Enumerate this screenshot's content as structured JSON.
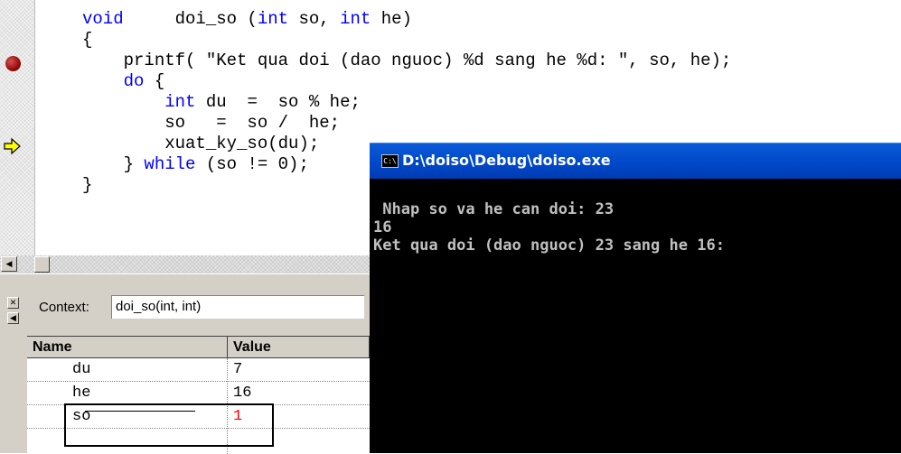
{
  "editor": {
    "lines": [
      {
        "parts": [
          {
            "t": "void",
            "kw": true
          },
          {
            "t": "     doi_so ("
          },
          {
            "t": "int",
            "kw": true
          },
          {
            "t": " so, "
          },
          {
            "t": "int",
            "kw": true
          },
          {
            "t": " he)"
          }
        ]
      },
      {
        "parts": [
          {
            "t": "{"
          }
        ]
      },
      {
        "parts": [
          {
            "t": "    printf( \"Ket qua doi (dao nguoc) %d sang he %d: \", so, he);"
          }
        ]
      },
      {
        "parts": [
          {
            "t": "    "
          },
          {
            "t": "do",
            "kw": true
          },
          {
            "t": " {"
          }
        ]
      },
      {
        "parts": [
          {
            "t": "        "
          },
          {
            "t": "int",
            "kw": true
          },
          {
            "t": " du  =  so % he;"
          }
        ]
      },
      {
        "parts": [
          {
            "t": "        so   =  so /  he;"
          }
        ]
      },
      {
        "parts": [
          {
            "t": "        xuat_ky_so(du);"
          }
        ]
      },
      {
        "parts": [
          {
            "t": "    } "
          },
          {
            "t": "while",
            "kw": true
          },
          {
            "t": " (so != 0);"
          }
        ]
      },
      {
        "parts": [
          {
            "t": "}"
          }
        ]
      }
    ]
  },
  "icons": {
    "breakpoint": "breakpoint-icon",
    "current_line": "current-line-arrow-icon",
    "scroll_left": "scroll-left-arrow-icon",
    "close": "close-icon",
    "pin": "pin-icon",
    "console": "console-icon"
  },
  "locals": {
    "context_label": "Context:",
    "context_value": "doi_so(int, int)",
    "headers": {
      "name": "Name",
      "value": "Value"
    },
    "rows": [
      {
        "name": "du",
        "value": "7",
        "changed": false
      },
      {
        "name": "he",
        "value": "16",
        "changed": false
      },
      {
        "name": "so",
        "value": "1",
        "changed": true
      }
    ]
  },
  "console": {
    "title": "D:\\doiso\\Debug\\doiso.exe",
    "icon_text": "C:\\",
    "output": " Nhap so va he can doi: 23\n16\nKet qua doi (dao nguoc) 23 sang he 16:"
  },
  "colors": {
    "keyword": "#0000ff",
    "changed_value": "#ff0000",
    "console_bg": "#000000",
    "console_text": "#c0c0c0",
    "title_bar": "#0047c8"
  }
}
